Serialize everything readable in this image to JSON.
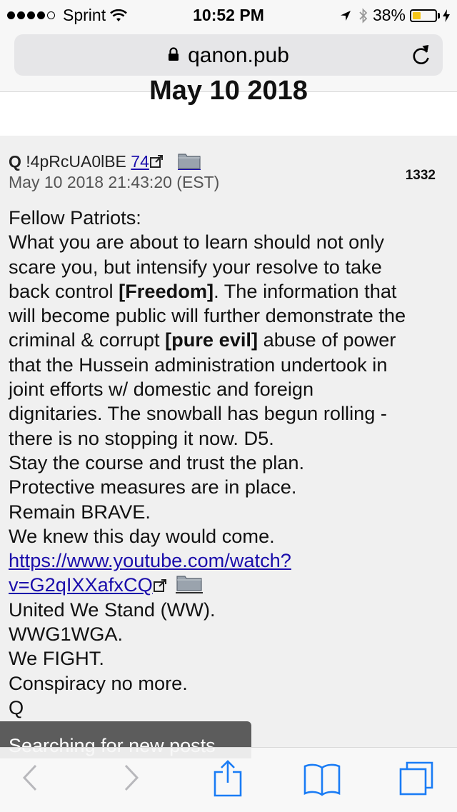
{
  "status_bar": {
    "carrier": "Sprint",
    "time": "10:52 PM",
    "battery_percent": "38%",
    "battery_level": 0.38,
    "signal_bars_filled": 4,
    "signal_bars_total": 5,
    "battery_color": "#f5c518",
    "icons": [
      "wifi-icon",
      "location-arrow-icon",
      "bluetooth-icon",
      "battery-icon",
      "charging-bolt-icon"
    ]
  },
  "address_bar": {
    "url": "qanon.pub",
    "icons": [
      "lock-icon",
      "reload-icon"
    ]
  },
  "page": {
    "date_heading": "May 10 2018"
  },
  "post": {
    "author": "Q",
    "tripcode": "!4pRcUA0lBE",
    "reply_count": "74",
    "timestamp": "May 10 2018 21:43:20 (EST)",
    "post_number": "1332",
    "body": {
      "l1": "Fellow Patriots:",
      "l2": "What you are about to learn should not only",
      "l3": "scare you, but intensify your resolve to take",
      "l4_pre": "back control ",
      "l4_bold": "[Freedom]",
      "l4_post": ". The information that",
      "l5": "will become public will further demonstrate the",
      "l6_pre": "criminal & corrupt ",
      "l6_bold": "[pure evil]",
      "l6_post": " abuse of power",
      "l7": "that the Hussein administration undertook in",
      "l8": "joint efforts w/ domestic and foreign",
      "l9": "dignitaries. The snowball has begun rolling -",
      "l10": "there is no stopping it now. D5.",
      "l11": "Stay the course and trust the plan.",
      "l12": "Protective measures are in place.",
      "l13": "Remain BRAVE.",
      "l14": "We knew this day would come.",
      "link_part1": "https://www.youtube.com/watch?",
      "link_part2": "v=G2qIXXafxCQ",
      "l15": "United We Stand (WW).",
      "l16": "WWG1WGA.",
      "l17": "We FIGHT.",
      "l18": "Conspiracy no more.",
      "l19": "Q"
    }
  },
  "toast": {
    "text": "Searching for new posts"
  },
  "toolbar": {
    "accent_color": "#1a7cf5",
    "buttons": [
      "back-icon",
      "forward-icon",
      "share-icon",
      "bookmarks-icon",
      "tabs-icon"
    ]
  }
}
